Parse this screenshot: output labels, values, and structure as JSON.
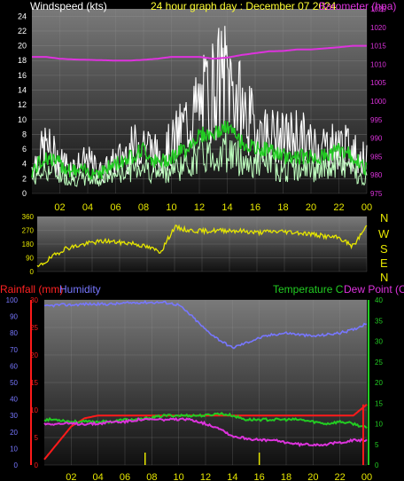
{
  "header": {
    "wind_title": "Windspeed (kts)",
    "graph_title": "24 hour graph day : December 07 2024",
    "baro_title": "Barometer (hpa)"
  },
  "bottom_header": {
    "rainfall": "Rainfall (mm)",
    "humidity": "Humidity",
    "temperature": "Temperature C",
    "dewpoint": "Dew Point (C)"
  },
  "compass": [
    "N",
    "W",
    "S",
    "E",
    "N"
  ],
  "x_ticks": [
    "02",
    "04",
    "06",
    "08",
    "10",
    "12",
    "14",
    "16",
    "18",
    "20",
    "22",
    "00"
  ],
  "colors": {
    "wind_gust": "#ffffff",
    "wind_avg": "#22cc22",
    "wind_light": "#bfffbf",
    "barometer": "#dd33dd",
    "direction": "#e6e600",
    "rain": "#ff1a1a",
    "humidity": "#7777ff",
    "temperature": "#22cc22",
    "dewpoint": "#dd33dd",
    "axis_yellow": "#e6e600"
  },
  "chart_data": [
    {
      "type": "line",
      "panel": "wind",
      "title": "Windspeed (kts)",
      "y_ticks": [
        "0",
        "2",
        "4",
        "6",
        "8",
        "10",
        "12",
        "14",
        "16",
        "18",
        "20",
        "22",
        "24"
      ],
      "right_ticks": [
        "975",
        "980",
        "985",
        "990",
        "995",
        "1000",
        "1005",
        "1010",
        "1015",
        "1020",
        "1025"
      ],
      "ylim": [
        0,
        25
      ],
      "right_ylim": [
        975,
        1025
      ],
      "x_hours": [
        0,
        1,
        2,
        3,
        4,
        5,
        6,
        7,
        8,
        9,
        10,
        11,
        12,
        13,
        14,
        15,
        16,
        17,
        18,
        19,
        20,
        21,
        22,
        23,
        24
      ],
      "series": [
        {
          "name": "gust",
          "values": [
            5,
            9,
            6,
            5,
            6,
            4,
            6,
            8,
            10,
            7,
            9,
            13,
            16,
            20,
            22,
            16,
            12,
            11,
            10,
            11,
            9,
            9,
            9,
            8,
            6
          ]
        },
        {
          "name": "average",
          "values": [
            3,
            5,
            4,
            3,
            3,
            3,
            4,
            5,
            6,
            4,
            5,
            6,
            8,
            8,
            9,
            7,
            6,
            6,
            5,
            5,
            5,
            5,
            6,
            5,
            3
          ]
        },
        {
          "name": "barometer",
          "values": [
            1012,
            1012,
            1011.5,
            1011.3,
            1011.2,
            1011.1,
            1011.0,
            1011.0,
            1011.2,
            1011.5,
            1012,
            1012,
            1012,
            1011.5,
            1011.8,
            1012.5,
            1013,
            1013.5,
            1013.6,
            1014,
            1014,
            1014.3,
            1014.6,
            1015,
            1015
          ]
        }
      ]
    },
    {
      "type": "line",
      "panel": "direction",
      "y_ticks": [
        "0",
        "90",
        "180",
        "270",
        "360"
      ],
      "ylim": [
        0,
        360
      ],
      "x_hours": [
        0,
        1,
        2,
        3,
        4,
        5,
        6,
        7,
        8,
        9,
        10,
        11,
        12,
        13,
        14,
        15,
        16,
        17,
        18,
        19,
        20,
        21,
        22,
        23,
        24
      ],
      "series": [
        {
          "name": "direction",
          "values": [
            25,
            90,
            150,
            170,
            190,
            200,
            190,
            185,
            160,
            130,
            290,
            270,
            265,
            268,
            270,
            265,
            255,
            262,
            262,
            255,
            245,
            230,
            220,
            165,
            300
          ]
        }
      ]
    },
    {
      "type": "line",
      "panel": "temp_hum_rain",
      "left_ticks": [
        "0",
        "5",
        "10",
        "15",
        "20",
        "25",
        "30"
      ],
      "left_ylim": [
        0,
        30
      ],
      "hum_ticks": [
        "0",
        "10",
        "20",
        "30",
        "40",
        "50",
        "60",
        "70",
        "80",
        "90",
        "100"
      ],
      "hum_ylim": [
        0,
        100
      ],
      "right_ticks": [
        "0",
        "5",
        "10",
        "15",
        "20",
        "25",
        "30",
        "35",
        "40"
      ],
      "right_ylim": [
        0,
        40
      ],
      "x_hours": [
        0,
        1,
        2,
        3,
        4,
        5,
        6,
        7,
        8,
        9,
        10,
        11,
        12,
        13,
        14,
        15,
        16,
        17,
        18,
        19,
        20,
        21,
        22,
        23,
        24
      ],
      "series": [
        {
          "name": "Rainfall (mm)",
          "values": [
            1,
            4,
            7,
            8.5,
            9,
            9,
            9,
            9,
            9,
            9,
            9,
            9,
            9,
            9,
            9,
            9,
            9,
            9,
            9,
            9,
            9,
            9,
            9,
            9,
            11
          ]
        },
        {
          "name": "Humidity",
          "values": [
            96,
            97,
            97,
            97.5,
            97.5,
            97.5,
            98,
            98.5,
            98.5,
            98.5,
            97,
            90,
            82,
            76,
            71,
            74,
            77,
            79,
            80,
            79,
            78,
            79,
            80,
            82,
            86
          ]
        },
        {
          "name": "Temperature C",
          "values": [
            11,
            11,
            10.5,
            10.5,
            10.5,
            10.5,
            11,
            11,
            11.5,
            12,
            12,
            12,
            12,
            12.5,
            12,
            11,
            11,
            11,
            11,
            11,
            10.5,
            10,
            10.5,
            10,
            9
          ]
        },
        {
          "name": "Dew Point (C)",
          "values": [
            10,
            10,
            10,
            10,
            10,
            10.5,
            10.5,
            11,
            11,
            11,
            11,
            11,
            10,
            9,
            7,
            6.5,
            6,
            6,
            5.5,
            5,
            5,
            5,
            5.5,
            6,
            6
          ]
        }
      ]
    }
  ]
}
